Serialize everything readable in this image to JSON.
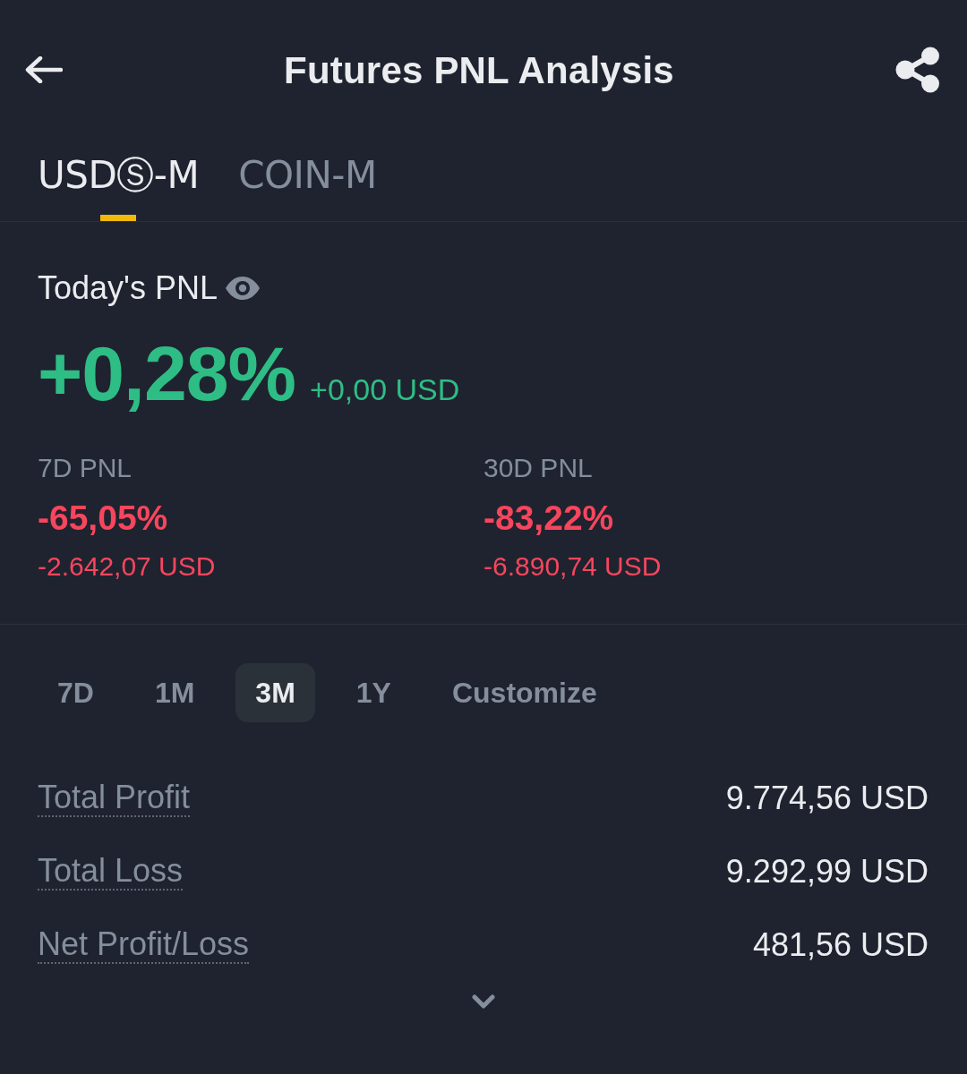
{
  "header": {
    "title": "Futures PNL Analysis"
  },
  "tabs": [
    {
      "label": "USDⓈ-M",
      "selected": true
    },
    {
      "label": "COIN-M",
      "selected": false
    }
  ],
  "today": {
    "label": "Today's PNL",
    "percent": "+0,28%",
    "amount": "+0,00 USD",
    "loss": false
  },
  "period_pnl": [
    {
      "label": "7D PNL",
      "percent": "-65,05%",
      "amount": "-2.642,07 USD",
      "loss": true
    },
    {
      "label": "30D PNL",
      "percent": "-83,22%",
      "amount": "-6.890,74 USD",
      "loss": true
    }
  ],
  "periods": [
    {
      "label": "7D",
      "selected": false
    },
    {
      "label": "1M",
      "selected": false
    },
    {
      "label": "3M",
      "selected": true
    },
    {
      "label": "1Y",
      "selected": false
    },
    {
      "label": "Customize",
      "selected": false
    }
  ],
  "metrics": [
    {
      "label": "Total Profit",
      "value": "9.774,56 USD"
    },
    {
      "label": "Total Loss",
      "value": "9.292,99 USD"
    },
    {
      "label": "Net Profit/Loss",
      "value": "481,56 USD"
    }
  ]
}
